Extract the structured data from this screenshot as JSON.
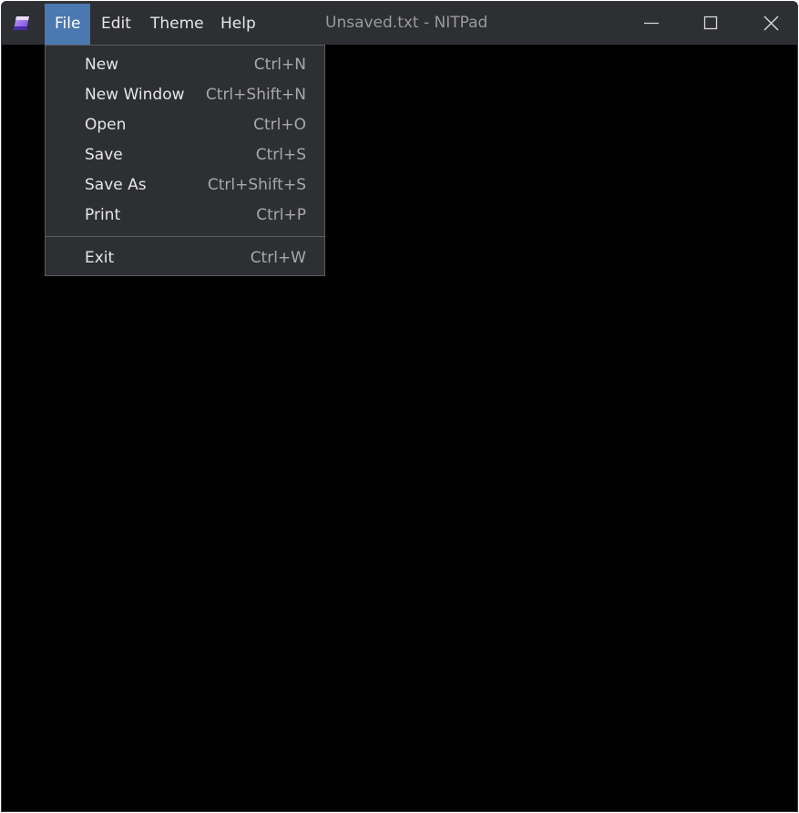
{
  "window": {
    "title": "Unsaved.txt - NITPad",
    "app_icon": "notepad-app-icon"
  },
  "menubar": {
    "items": [
      {
        "label": "File",
        "active": true
      },
      {
        "label": "Edit",
        "active": false
      },
      {
        "label": "Theme",
        "active": false
      },
      {
        "label": "Help",
        "active": false
      }
    ]
  },
  "window_controls": {
    "minimize_icon": "minimize-icon",
    "maximize_icon": "maximize-icon",
    "close_icon": "close-icon"
  },
  "file_menu": {
    "items": [
      {
        "label": "New",
        "shortcut": "Ctrl+N"
      },
      {
        "label": "New Window",
        "shortcut": "Ctrl+Shift+N"
      },
      {
        "label": "Open",
        "shortcut": "Ctrl+O"
      },
      {
        "label": "Save",
        "shortcut": "Ctrl+S"
      },
      {
        "label": "Save As",
        "shortcut": "Ctrl+Shift+S"
      },
      {
        "label": "Print",
        "shortcut": "Ctrl+P"
      }
    ],
    "exit": {
      "label": "Exit",
      "shortcut": "Ctrl+W"
    }
  },
  "colors": {
    "editor_background": "#000000",
    "titlebar_background": "#2d2f33",
    "active_menu_accent": "#4a78b0"
  }
}
